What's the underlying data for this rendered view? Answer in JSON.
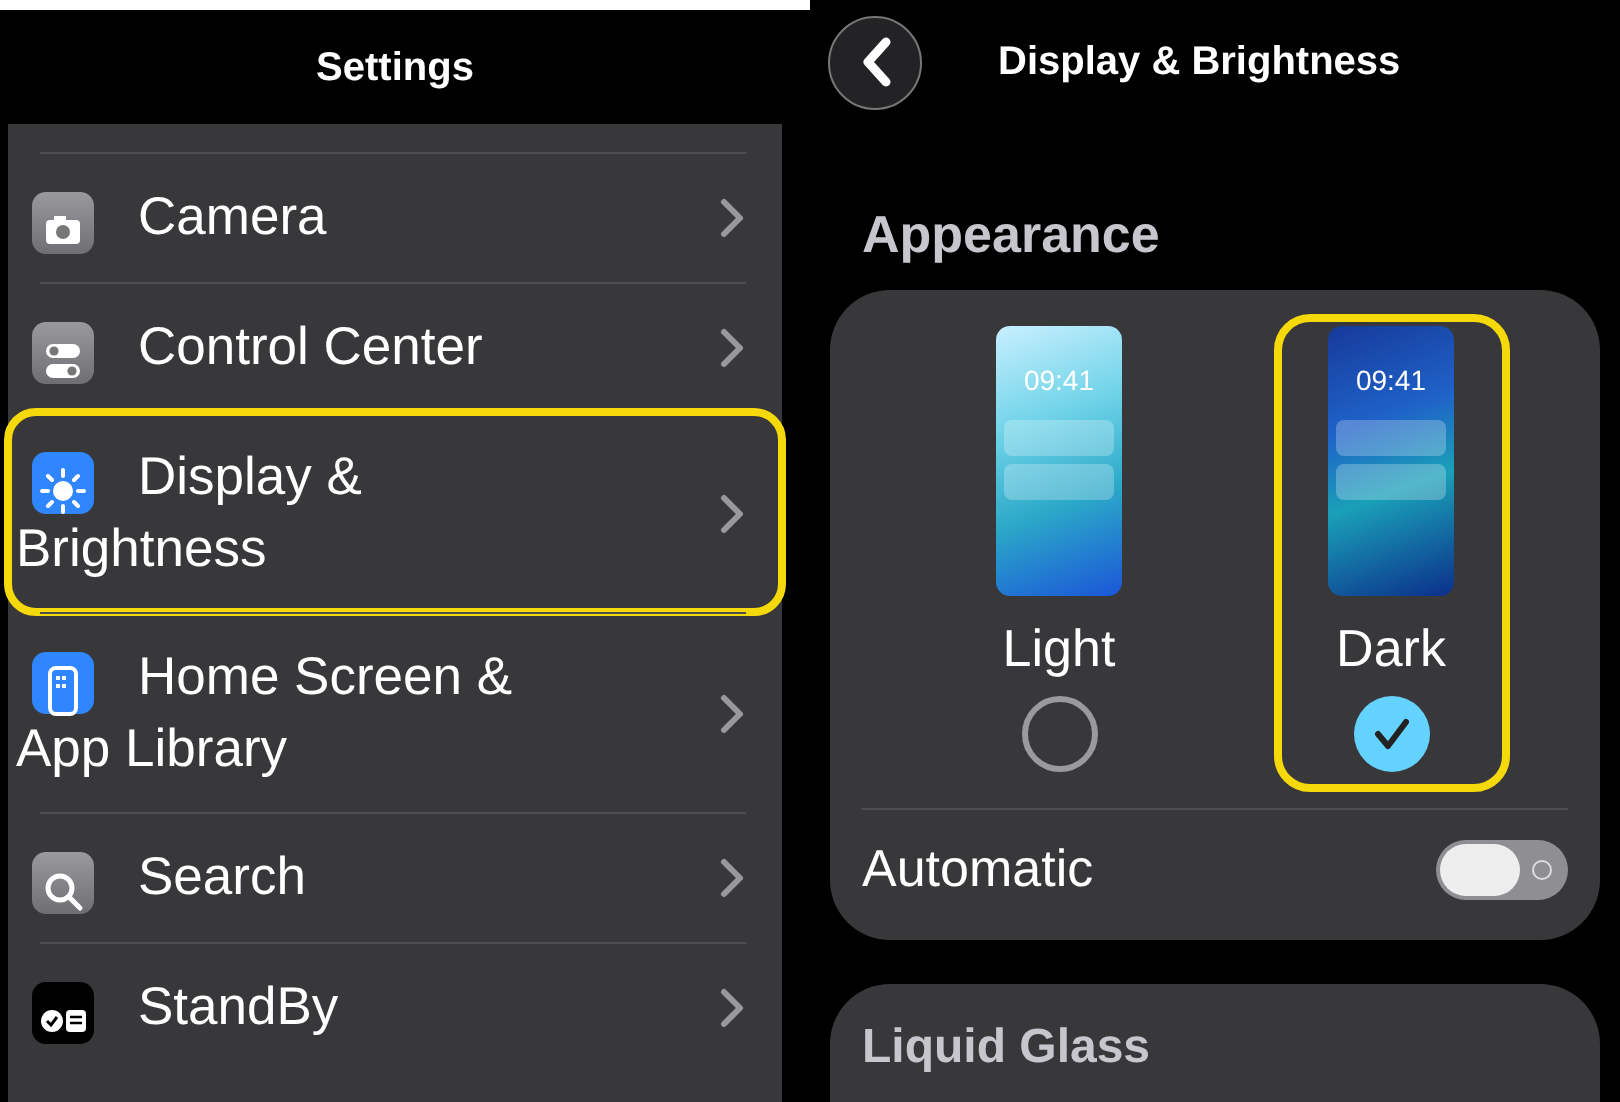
{
  "settings_screen": {
    "title": "Settings",
    "items": [
      {
        "label": "Camera",
        "highlighted": false
      },
      {
        "label": "Control Center",
        "highlighted": false
      },
      {
        "label": "Display & Brightness",
        "highlighted": true
      },
      {
        "label": "Home Screen & App Library",
        "highlighted": false
      },
      {
        "label": "Search",
        "highlighted": false
      },
      {
        "label": "StandBy",
        "highlighted": false
      }
    ]
  },
  "display_screen": {
    "title": "Display & Brightness",
    "section": "Appearance",
    "options": [
      {
        "label": "Light",
        "kind": "light",
        "clock": "09:41",
        "selected": false,
        "highlighted": false
      },
      {
        "label": "Dark",
        "kind": "dark",
        "clock": "09:41",
        "selected": true,
        "highlighted": true
      }
    ],
    "automatic": {
      "label": "Automatic",
      "on": false
    },
    "next_section": "Liquid Glass"
  }
}
